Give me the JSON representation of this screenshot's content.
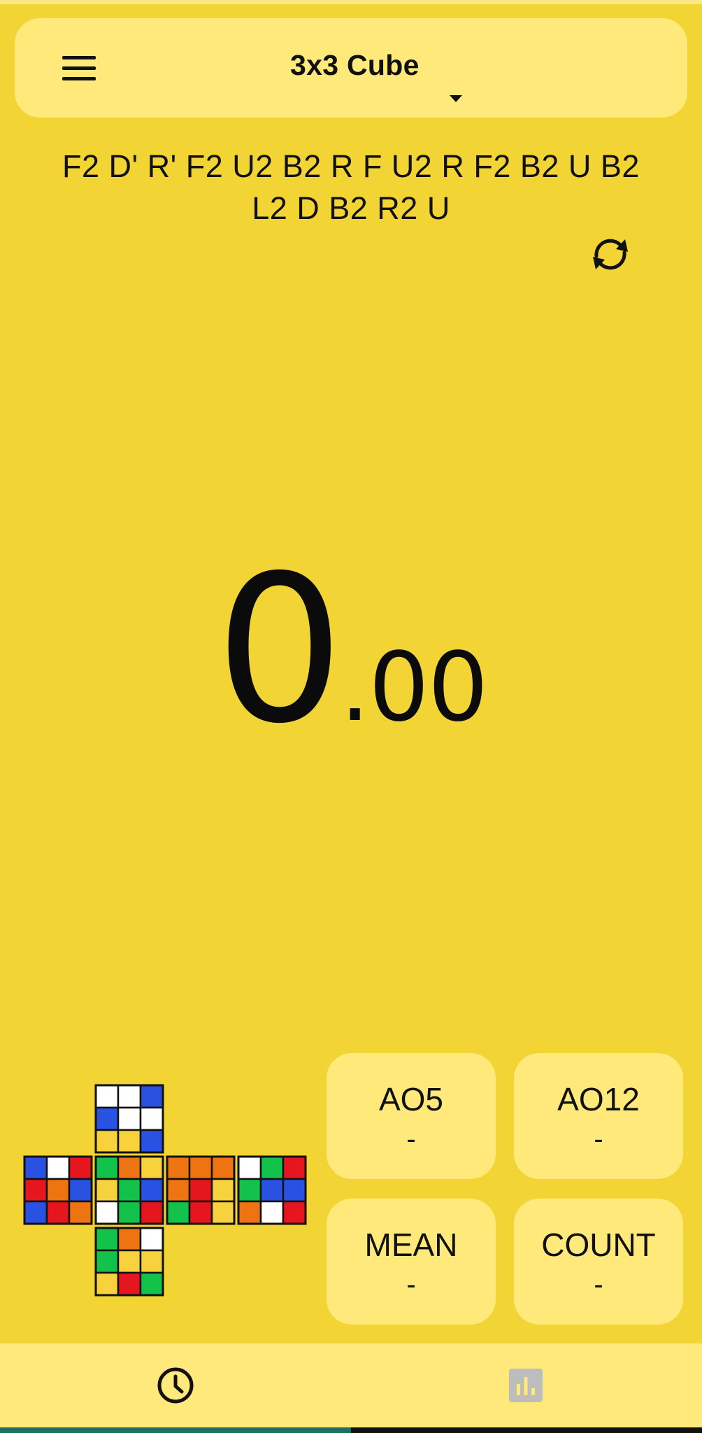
{
  "app_bar": {
    "menu_icon": "hamburger-menu-icon",
    "puzzle_title": "3x3 Cube",
    "dropdown_icon": "caret-down-icon"
  },
  "scramble": {
    "text": "F2 D' R' F2 U2 B2 R F U2 R F2 B2 U B2 L2 D B2 R2 U",
    "refresh_icon": "refresh-icon"
  },
  "timer": {
    "seconds": "0",
    "fraction": ".00"
  },
  "cube_preview": {
    "colors": {
      "W": "#FFFFFF",
      "B": "#2952E3",
      "Y": "#F7D23C",
      "G": "#12C24A",
      "R": "#E5161D",
      "O": "#EE7411"
    },
    "faces": {
      "top": [
        [
          "W",
          "W",
          "B"
        ],
        [
          "B",
          "W",
          "W"
        ],
        [
          "Y",
          "Y",
          "B"
        ]
      ],
      "left": [
        [
          "B",
          "W",
          "R"
        ],
        [
          "R",
          "O",
          "B"
        ],
        [
          "B",
          "R",
          "O"
        ]
      ],
      "front": [
        [
          "G",
          "O",
          "Y"
        ],
        [
          "Y",
          "G",
          "B"
        ],
        [
          "W",
          "G",
          "R"
        ]
      ],
      "right": [
        [
          "O",
          "O",
          "O"
        ],
        [
          "O",
          "R",
          "Y"
        ],
        [
          "G",
          "R",
          "Y"
        ]
      ],
      "back": [
        [
          "W",
          "G",
          "R"
        ],
        [
          "G",
          "B",
          "B"
        ],
        [
          "O",
          "W",
          "R"
        ]
      ],
      "bottom": [
        [
          "G",
          "O",
          "W"
        ],
        [
          "G",
          "Y",
          "Y"
        ],
        [
          "Y",
          "R",
          "G"
        ]
      ]
    }
  },
  "stats": [
    {
      "label": "AO5",
      "value": "-"
    },
    {
      "label": "AO12",
      "value": "-"
    },
    {
      "label": "MEAN",
      "value": "-"
    },
    {
      "label": "COUNT",
      "value": "-"
    }
  ],
  "bottom_nav": {
    "items": [
      {
        "icon": "clock-icon",
        "active": true,
        "color": "#111111"
      },
      {
        "icon": "bar-chart-icon",
        "active": false,
        "color": "#BDBDBD"
      }
    ],
    "indicator_color": "#1F6F5F"
  },
  "theme": {
    "background": "#F2D535",
    "surface": "#FFE97A"
  }
}
